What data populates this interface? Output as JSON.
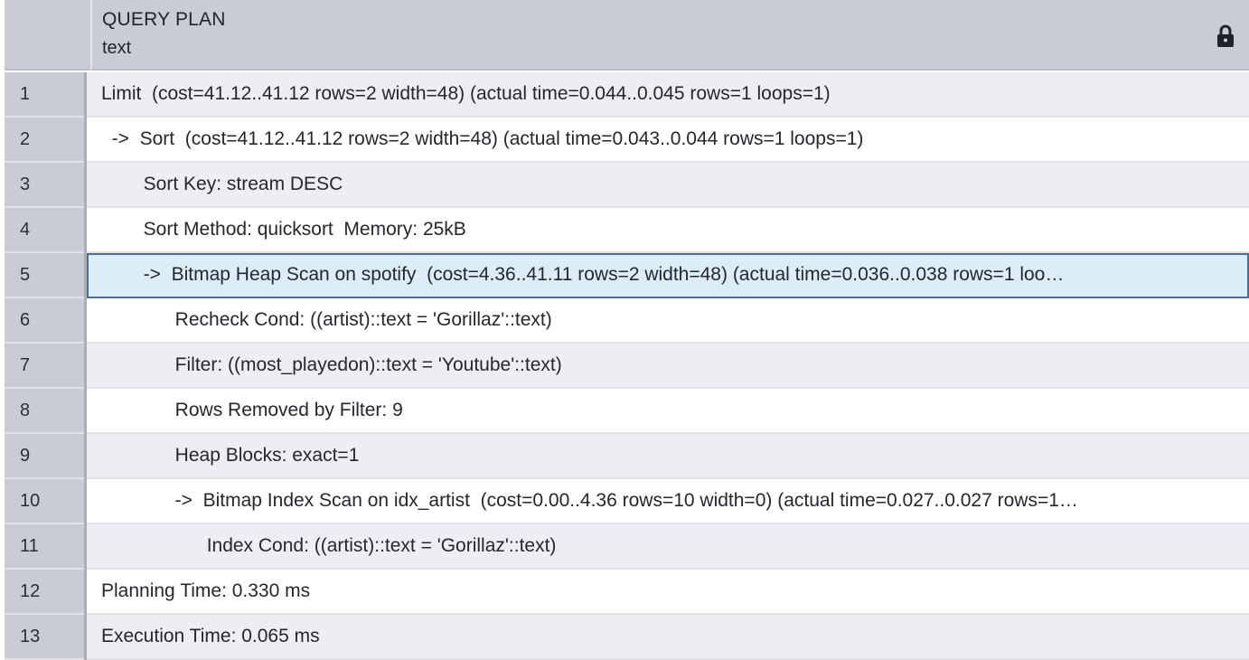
{
  "column": {
    "name": "QUERY PLAN",
    "type": "text"
  },
  "rows": [
    {
      "num": "1",
      "text": "Limit  (cost=41.12..41.12 rows=2 width=48) (actual time=0.044..0.045 rows=1 loops=1)"
    },
    {
      "num": "2",
      "text": "  ->  Sort  (cost=41.12..41.12 rows=2 width=48) (actual time=0.043..0.044 rows=1 loops=1)"
    },
    {
      "num": "3",
      "text": "        Sort Key: stream DESC"
    },
    {
      "num": "4",
      "text": "        Sort Method: quicksort  Memory: 25kB"
    },
    {
      "num": "5",
      "text": "        ->  Bitmap Heap Scan on spotify  (cost=4.36..41.11 rows=2 width=48) (actual time=0.036..0.038 rows=1 loo…"
    },
    {
      "num": "6",
      "text": "              Recheck Cond: ((artist)::text = 'Gorillaz'::text)"
    },
    {
      "num": "7",
      "text": "              Filter: ((most_playedon)::text = 'Youtube'::text)"
    },
    {
      "num": "8",
      "text": "              Rows Removed by Filter: 9"
    },
    {
      "num": "9",
      "text": "              Heap Blocks: exact=1"
    },
    {
      "num": "10",
      "text": "              ->  Bitmap Index Scan on idx_artist  (cost=0.00..4.36 rows=10 width=0) (actual time=0.027..0.027 rows=1…"
    },
    {
      "num": "11",
      "text": "                    Index Cond: ((artist)::text = 'Gorillaz'::text)"
    },
    {
      "num": "12",
      "text": "Planning Time: 0.330 ms"
    },
    {
      "num": "13",
      "text": "Execution Time: 0.065 ms"
    }
  ],
  "selected_row": "5",
  "colors": {
    "header_bg": "#c9ccd5",
    "row_alt_bg": "#eceef2",
    "selected_bg": "#dcedf8",
    "selected_border": "#4f6e94"
  },
  "icons": {
    "lock": "lock-icon"
  }
}
